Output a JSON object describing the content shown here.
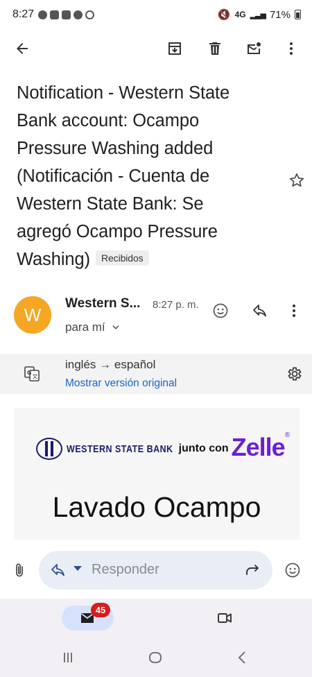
{
  "status_bar": {
    "time": "8:27",
    "network": "4G",
    "battery": "71%"
  },
  "email": {
    "subject": "Notification -  Western State Bank account: Ocampo Pressure Washing added (Notificación - Cuenta de Western State Bank: Se agregó Ocampo Pressure Washing)",
    "label": "Recibidos",
    "sender_initial": "W",
    "sender_name": "Western S...",
    "time": "8:27 p. m.",
    "recipient": "para mí"
  },
  "translation": {
    "languages": "inglés → español",
    "show_original": "Mostrar versión original"
  },
  "body": {
    "bank_name": "WESTERN STATE BANK",
    "junto": "junto con",
    "zelle": "Zelle",
    "zelle_mark": "®",
    "payee": "Lavado Ocampo"
  },
  "reply": {
    "placeholder": "Responder"
  },
  "bottom_nav": {
    "mail_badge": "45"
  },
  "icons": {
    "back": "arrow-left-icon",
    "archive": "archive-icon",
    "delete": "trash-icon",
    "mark_unread": "mark-unread-icon",
    "more": "more-vert-icon",
    "star": "star-icon",
    "emoji": "emoji-icon",
    "reply": "reply-icon",
    "translate": "translate-icon",
    "settings": "gear-icon",
    "attach": "paperclip-icon",
    "forward": "forward-icon",
    "mail": "mail-icon",
    "meet": "video-icon"
  },
  "colors": {
    "avatar": "#f5a623",
    "link": "#1a64c8",
    "zelle": "#6d1ed4",
    "badge": "#d81b1b",
    "nav_active": "#d6e2fb"
  }
}
